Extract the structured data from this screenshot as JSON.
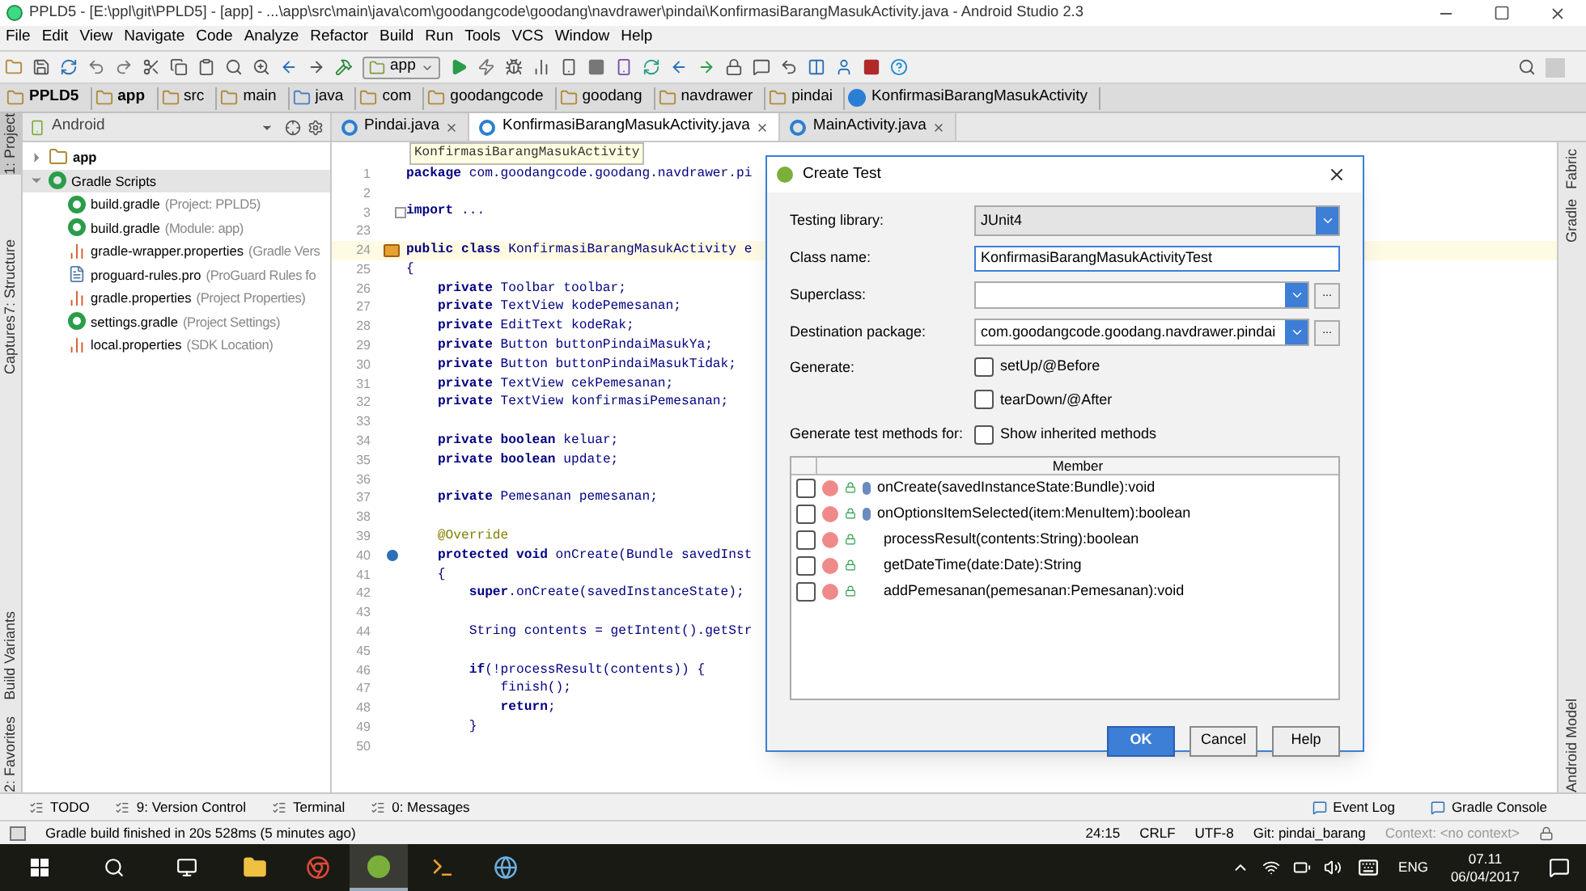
{
  "window": {
    "title": "PPLD5 - [E:\\ppl\\git\\PPLD5] - [app] - ...\\app\\src\\main\\java\\com\\goodangcode\\goodang\\navdrawer\\pindai\\KonfirmasiBarangMasukActivity.java - Android Studio 2.3"
  },
  "menu": [
    "File",
    "Edit",
    "View",
    "Navigate",
    "Code",
    "Analyze",
    "Refactor",
    "Build",
    "Run",
    "Tools",
    "VCS",
    "Window",
    "Help"
  ],
  "toolbar": {
    "run_config": "app"
  },
  "breadcrumbs": [
    {
      "label": "PPLD5",
      "kind": "project"
    },
    {
      "label": "app",
      "kind": "module"
    },
    {
      "label": "src",
      "kind": "folder"
    },
    {
      "label": "main",
      "kind": "folder"
    },
    {
      "label": "java",
      "kind": "source"
    },
    {
      "label": "com",
      "kind": "package"
    },
    {
      "label": "goodangcode",
      "kind": "package"
    },
    {
      "label": "goodang",
      "kind": "package"
    },
    {
      "label": "navdrawer",
      "kind": "package"
    },
    {
      "label": "pindai",
      "kind": "package"
    },
    {
      "label": "KonfirmasiBarangMasukActivity",
      "kind": "class"
    }
  ],
  "left_strip": [
    "1: Project",
    "7: Structure",
    "Captures",
    "Build Variants",
    "2: Favorites"
  ],
  "right_strip": [
    "Fabric",
    "Gradle",
    "Android Model"
  ],
  "project_panel": {
    "view": "Android",
    "tree": [
      {
        "label": "app",
        "kind": "module",
        "expanded": false
      },
      {
        "label": "Gradle Scripts",
        "kind": "gradle",
        "expanded": true,
        "children": [
          {
            "label": "build.gradle",
            "hint": "(Project: PPLD5)",
            "kind": "gradle"
          },
          {
            "label": "build.gradle",
            "hint": "(Module: app)",
            "kind": "gradle"
          },
          {
            "label": "gradle-wrapper.properties",
            "hint": "(Gradle Vers",
            "kind": "properties"
          },
          {
            "label": "proguard-rules.pro",
            "hint": "(ProGuard Rules fo",
            "kind": "file"
          },
          {
            "label": "gradle.properties",
            "hint": "(Project Properties)",
            "kind": "properties"
          },
          {
            "label": "settings.gradle",
            "hint": "(Project Settings)",
            "kind": "gradle"
          },
          {
            "label": "local.properties",
            "hint": "(SDK Location)",
            "kind": "properties"
          }
        ]
      }
    ]
  },
  "editor_tabs": [
    {
      "label": "Pindai.java",
      "selected": false
    },
    {
      "label": "KonfirmasiBarangMasukActivity.java",
      "selected": true
    },
    {
      "label": "MainActivity.java",
      "selected": false
    }
  ],
  "editor": {
    "tooltip": "KonfirmasiBarangMasukActivity",
    "lines": [
      {
        "number": "1",
        "text": "**package** com.goodangcode.goodang.navdrawer.pi"
      },
      {
        "number": "2"
      },
      {
        "number": "3",
        "text": "**import** ...",
        "kind": "fold"
      },
      {
        "number": "23"
      },
      {
        "number": "24",
        "text": "**public class** KonfirmasiBarangMasukActivity e",
        "kind": "current"
      },
      {
        "number": "25",
        "text": "{"
      },
      {
        "number": "26",
        "text": "    **private** Toolbar toolbar;"
      },
      {
        "number": "27",
        "text": "    **private** TextView kodePemesanan;"
      },
      {
        "number": "28",
        "text": "    **private** EditText kodeRak;"
      },
      {
        "number": "29",
        "text": "    **private** Button buttonPindaiMasukYa;"
      },
      {
        "number": "30",
        "text": "    **private** Button buttonPindaiMasukTidak;"
      },
      {
        "number": "31",
        "text": "    **private** TextView cekPemesanan;"
      },
      {
        "number": "32",
        "text": "    **private** TextView konfirmasiPemesanan;"
      },
      {
        "number": "33"
      },
      {
        "number": "34",
        "text": "    **private boolean** keluar;"
      },
      {
        "number": "35",
        "text": "    **private boolean** update;"
      },
      {
        "number": "36"
      },
      {
        "number": "37",
        "text": "    **private** Pemesanan pemesanan;"
      },
      {
        "number": "38"
      },
      {
        "number": "39",
        "text": "    @Override",
        "kind": "annotation"
      },
      {
        "number": "40",
        "text": "    **protected void** onCreate(Bundle savedInst",
        "kind": "override"
      },
      {
        "number": "41",
        "text": "    {"
      },
      {
        "number": "42",
        "text": "        **super**.onCreate(savedInstanceState);"
      },
      {
        "number": "43"
      },
      {
        "number": "44",
        "text": "        String contents = getIntent().getStr"
      },
      {
        "number": "45"
      },
      {
        "number": "46",
        "text": "        **if**(!processResult(contents)) {"
      },
      {
        "number": "47",
        "text": "            finish();"
      },
      {
        "number": "48",
        "text": "            **return**;"
      },
      {
        "number": "49",
        "text": "        }"
      },
      {
        "number": "50"
      }
    ]
  },
  "dialog": {
    "title": "Create Test",
    "testing_library_label": "Testing library:",
    "testing_library": "JUnit4",
    "class_name_label": "Class name:",
    "class_name": "KonfirmasiBarangMasukActivityTest",
    "superclass_label": "Superclass:",
    "destination_label": "Destination package:",
    "destination": "com.goodangcode.goodang.navdrawer.pindai",
    "browse": "...",
    "generate_label": "Generate:",
    "generate_options": [
      {
        "label": "setUp/@Before",
        "checked": false
      },
      {
        "label": "tearDown/@After",
        "checked": false
      }
    ],
    "methods_label": "Generate test methods for:",
    "show_inherited": {
      "label": "Show inherited methods",
      "checked": false
    },
    "member_header": "Member",
    "members": [
      {
        "label": "onCreate(savedInstanceState:Bundle):void",
        "checked": false,
        "kind": "override"
      },
      {
        "label": "onOptionsItemSelected(item:MenuItem):boolean",
        "checked": false,
        "kind": "override"
      },
      {
        "label": "processResult(contents:String):boolean",
        "checked": false,
        "kind": "plain"
      },
      {
        "label": "getDateTime(date:Date):String",
        "checked": false,
        "kind": "plain"
      },
      {
        "label": "addPemesanan(pemesanan:Pemesanan):void",
        "checked": false,
        "kind": "plain"
      }
    ],
    "buttons": [
      {
        "label": "OK",
        "kind": "primary"
      },
      {
        "label": "Cancel",
        "kind": "normal"
      },
      {
        "label": "Help",
        "kind": "normal"
      }
    ]
  },
  "tool_tabs": {
    "left": [
      "TODO",
      "9: Version Control",
      "Terminal",
      "0: Messages"
    ],
    "right": [
      "Event Log",
      "Gradle Console"
    ]
  },
  "status_bar": {
    "message": "Gradle build finished in 20s 528ms (5 minutes ago)",
    "position": "24:15",
    "line_separator": "CRLF",
    "encoding": "UTF-8",
    "git": "Git: pindai_barang",
    "context": "Context: <no context>"
  },
  "taskbar": {
    "language": "ENG",
    "time": "07.11",
    "date": "06/04/2017"
  }
}
